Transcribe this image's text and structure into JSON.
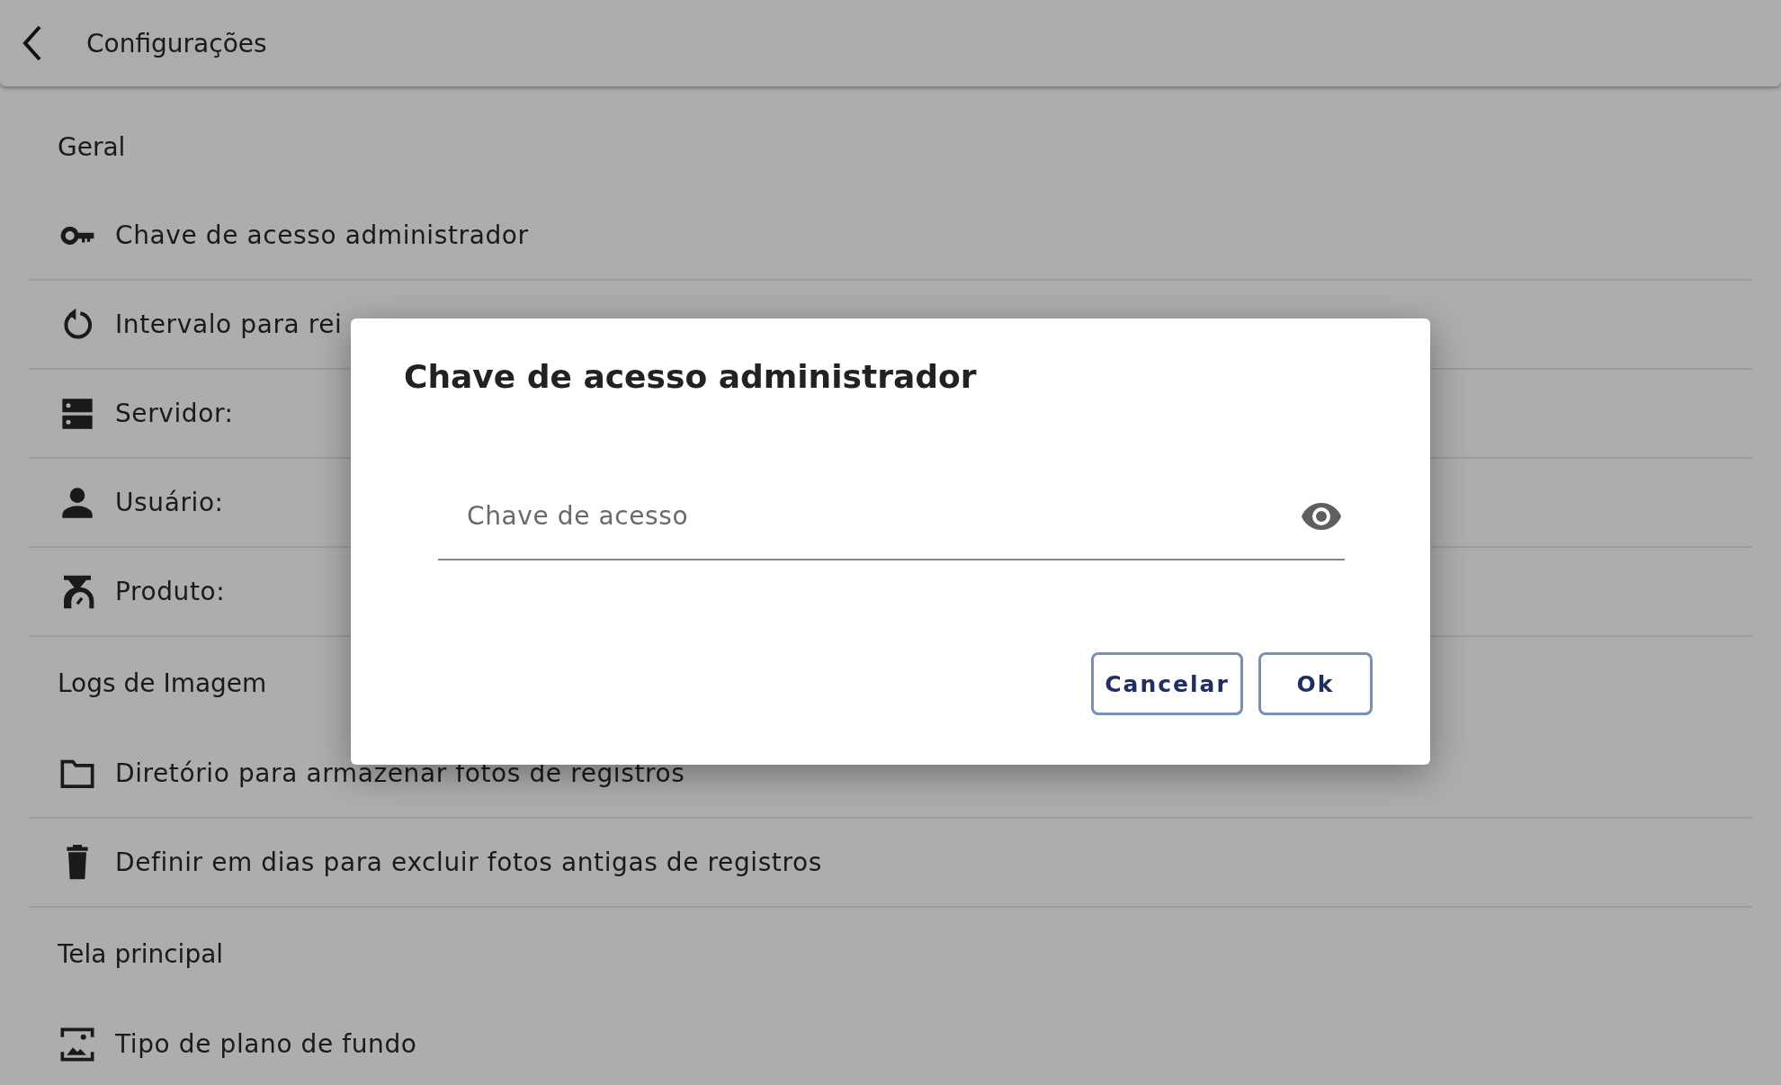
{
  "header": {
    "title": "Configurações"
  },
  "sections": [
    {
      "title": "Geral",
      "items": [
        {
          "label": "Chave de acesso administrador"
        },
        {
          "label": "Intervalo para rei"
        },
        {
          "label": "Servidor:"
        },
        {
          "label": "Usuário:"
        },
        {
          "label": "Produto:"
        }
      ]
    },
    {
      "title": "Logs de Imagem",
      "items": [
        {
          "label": "Diretório para armazenar fotos de registros"
        },
        {
          "label": "Definir em dias para excluir fotos antigas de registros"
        }
      ]
    },
    {
      "title": "Tela principal",
      "items": [
        {
          "label": "Tipo de plano de fundo"
        }
      ]
    }
  ],
  "dialog": {
    "title": "Chave de acesso administrador",
    "field": {
      "placeholder": "Chave de acesso"
    },
    "buttons": [
      "Cancelar",
      "Ok"
    ]
  }
}
